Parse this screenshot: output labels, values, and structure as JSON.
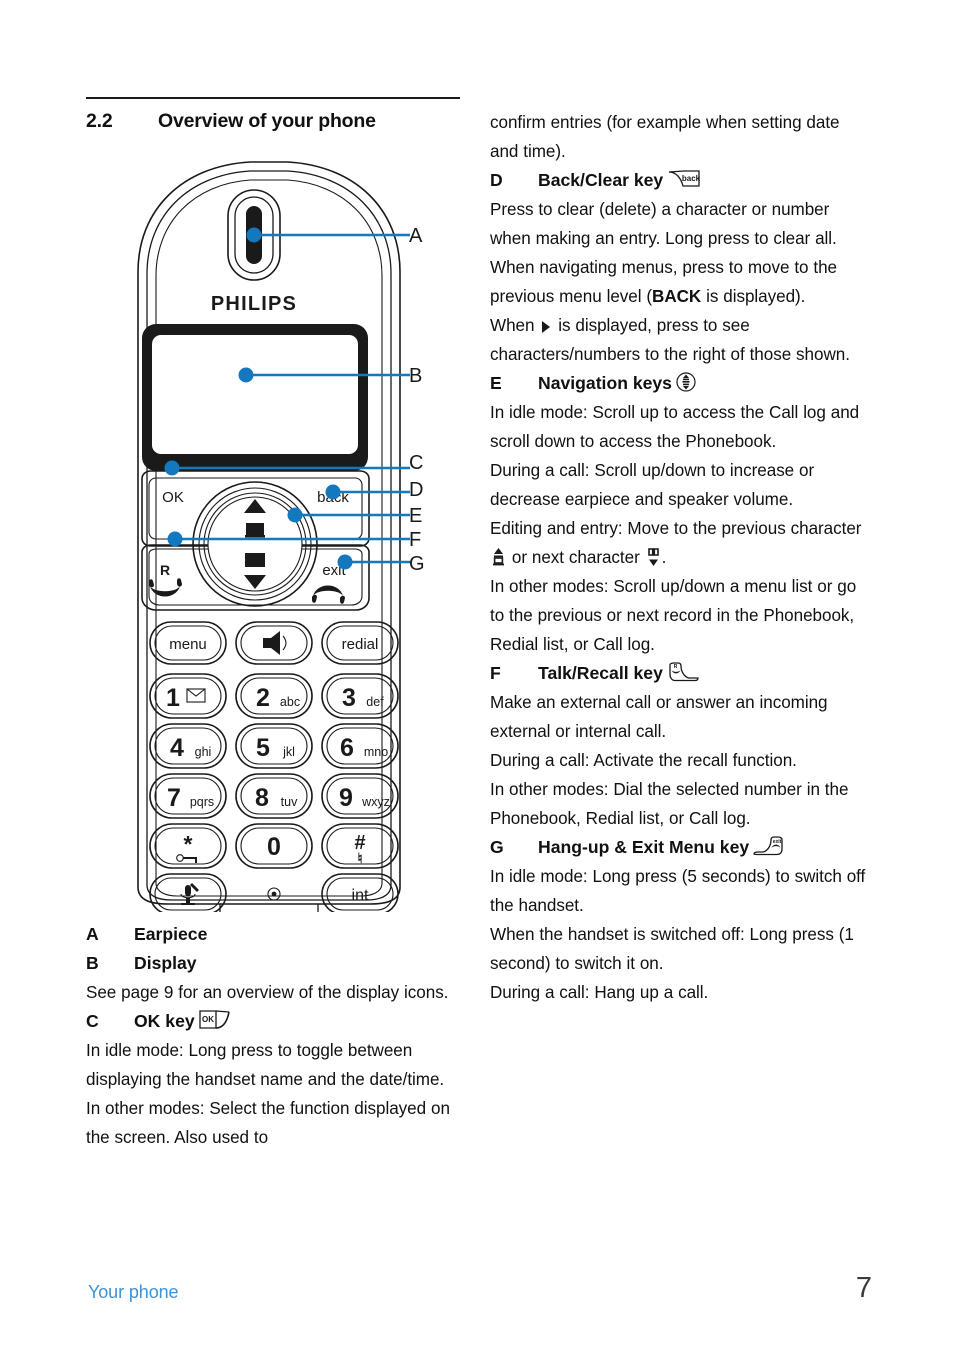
{
  "heading": {
    "number": "2.2",
    "title": "Overview of your phone"
  },
  "colors": {
    "callout_blue": "#1478be",
    "footer_blue": "#3d92d8",
    "text": "#111111"
  },
  "phone": {
    "brand": "PHILIPS",
    "softkeys": {
      "left": "OK",
      "right": "back"
    },
    "talk_key_label": "R",
    "exit_key_label": "exit",
    "keypad": [
      [
        {
          "main": "menu",
          "sub": "",
          "type": "function"
        },
        {
          "main": "speaker-icon",
          "sub": "",
          "type": "icon"
        },
        {
          "main": "redial",
          "sub": "",
          "type": "function"
        }
      ],
      [
        {
          "main": "1",
          "sub": "voicemail-icon",
          "type": "digit"
        },
        {
          "main": "2",
          "sub": "abc",
          "type": "digit"
        },
        {
          "main": "3",
          "sub": "def",
          "type": "digit"
        }
      ],
      [
        {
          "main": "4",
          "sub": "ghi",
          "type": "digit"
        },
        {
          "main": "5",
          "sub": "jkl",
          "type": "digit"
        },
        {
          "main": "6",
          "sub": "mno",
          "type": "digit"
        }
      ],
      [
        {
          "main": "7",
          "sub": "pqrs",
          "type": "digit"
        },
        {
          "main": "8",
          "sub": "tuv",
          "type": "digit"
        },
        {
          "main": "9",
          "sub": "wxyz",
          "type": "digit"
        }
      ],
      [
        {
          "main": "*",
          "sub": "key-lock-icon",
          "type": "digit"
        },
        {
          "main": "0",
          "sub": "",
          "type": "digit"
        },
        {
          "main": "#",
          "sub": "ringer-icon",
          "type": "digit"
        }
      ],
      [
        {
          "main": "mute-icon",
          "sub": "",
          "type": "icon"
        },
        {
          "main": "microphone-hole",
          "sub": "",
          "type": "hole"
        },
        {
          "main": "int",
          "sub": "",
          "type": "function"
        }
      ]
    ]
  },
  "callouts": [
    {
      "letter": "A",
      "target": "earpiece"
    },
    {
      "letter": "B",
      "target": "display"
    },
    {
      "letter": "C",
      "target": "ok-key"
    },
    {
      "letter": "D",
      "target": "back-clear-key"
    },
    {
      "letter": "E",
      "target": "navigation-keys"
    },
    {
      "letter": "F",
      "target": "talk-recall-key"
    },
    {
      "letter": "G",
      "target": "hangup-exit-key"
    }
  ],
  "left_column": {
    "item_a": {
      "letter": "A",
      "title": "Earpiece"
    },
    "item_b": {
      "letter": "B",
      "title": "Display"
    },
    "item_b_body": "See page 9 for an overview of the display icons.",
    "item_c": {
      "letter": "C",
      "title": "OK key",
      "icon": "ok-key-icon",
      "icon_label": "OK"
    },
    "item_c_body_1": "In idle mode: Long press to toggle between displaying the handset name and the date/time.",
    "item_c_body_2": "In other modes: Select the function displayed on the screen. Also used to"
  },
  "right_column": {
    "continuation": "confirm entries (for example when setting date and time).",
    "item_d": {
      "letter": "D",
      "title": "Back/Clear key",
      "icon": "back-key-icon",
      "icon_label": "back"
    },
    "item_d_body_1": "Press to clear (delete) a character or number when making an entry. Long press to clear all.",
    "item_d_body_2_pre": "When navigating menus, press to move to the previous menu level (",
    "item_d_body_2_bold": "BACK",
    "item_d_body_2_post": " is displayed).",
    "item_d_body_3_pre": "When ",
    "item_d_body_3_post": " is displayed, press to see characters/numbers to the right of those shown.",
    "item_e": {
      "letter": "E",
      "title": "Navigation keys",
      "icon": "navigation-key-icon"
    },
    "item_e_body_1": "In idle mode: Scroll up to access the Call log and scroll down to access the Phonebook.",
    "item_e_body_2": "During a call: Scroll up/down to increase or decrease earpiece and speaker volume.",
    "item_e_body_3_pre": "Editing and entry: Move to the previous character ",
    "item_e_body_3_mid": " or next character ",
    "item_e_body_3_post": ".",
    "item_e_body_4": "In other modes: Scroll up/down a menu list or go to the previous or next record in the Phonebook, Redial list, or Call log.",
    "item_f": {
      "letter": "F",
      "title": "Talk/Recall key",
      "icon": "talk-recall-key-icon",
      "icon_label": "R"
    },
    "item_f_body_1": "Make an external call or answer an incoming external or internal call.",
    "item_f_body_2": "During a call: Activate the recall function.",
    "item_f_body_3": "In other modes: Dial the selected number in the Phonebook, Redial list, or Call log.",
    "item_g": {
      "letter": "G",
      "title": "Hang-up & Exit Menu key",
      "icon": "hangup-key-icon",
      "icon_label": "exit"
    },
    "item_g_body_1": "In idle mode: Long press (5 seconds) to switch off the handset.",
    "item_g_body_2": "When the handset is switched off: Long press (1 second) to switch it on.",
    "item_g_body_3": "During a call: Hang up a call."
  },
  "footer": {
    "chapter": "Your phone",
    "page_number": "7"
  }
}
